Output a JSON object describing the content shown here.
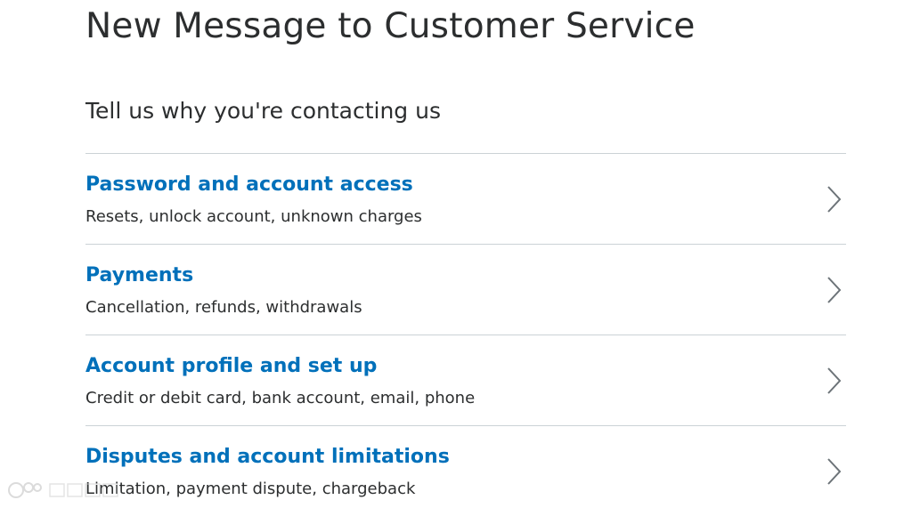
{
  "page": {
    "title": "New Message to Customer Service",
    "subtitle": "Tell us why you're contacting us"
  },
  "topics": [
    {
      "title": "Password and account access",
      "description": "Resets, unlock account, unknown charges",
      "icon": "chevron-right-icon"
    },
    {
      "title": "Payments",
      "description": "Cancellation, refunds, withdrawals",
      "icon": "chevron-right-icon"
    },
    {
      "title": "Account profile and set up",
      "description": "Credit or debit card, bank account, email, phone",
      "icon": "chevron-right-icon"
    },
    {
      "title": "Disputes and account limitations",
      "description": "Limitation, payment dispute, chargeback",
      "icon": "chevron-right-icon"
    }
  ],
  "colors": {
    "link_blue": "#0070ba",
    "text_dark": "#2c2e2f",
    "divider": "#cbd2d6",
    "chevron": "#6c7378"
  }
}
